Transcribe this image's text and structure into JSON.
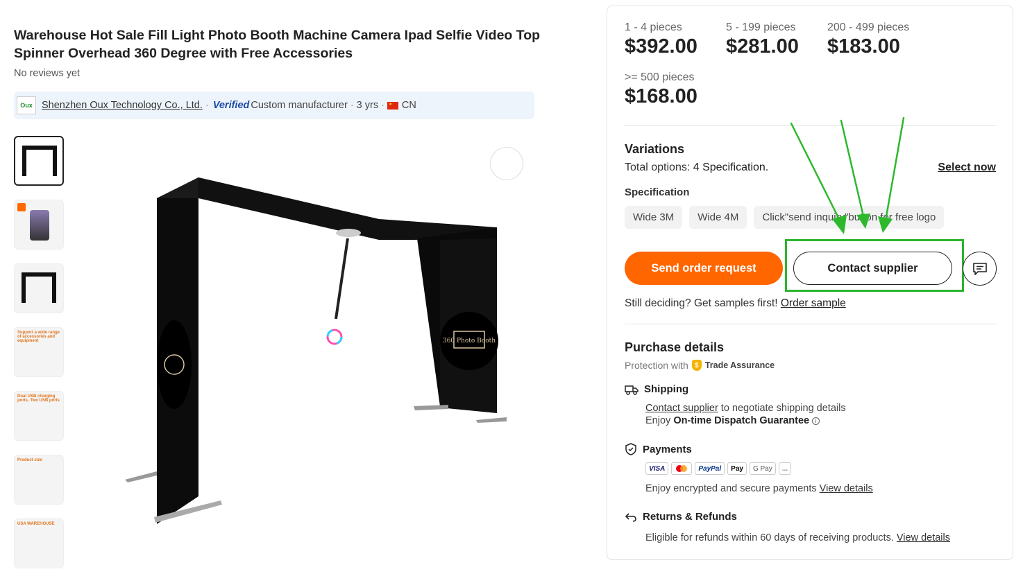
{
  "product": {
    "title": "Warehouse Hot Sale Fill Light Photo Booth Machine Camera Ipad Selfie Video Top Spinner Overhead 360 Degree with Free Accessories",
    "reviews": "No reviews yet"
  },
  "supplier": {
    "logo_text": "Oux",
    "name": "Shenzhen Oux Technology Co., Ltd.",
    "verified": "Verified",
    "type": "Custom manufacturer",
    "years": "3 yrs",
    "country": "CN"
  },
  "image": {
    "sign_text": "360 Photo Booth"
  },
  "thumbnails": [
    {
      "label": ""
    },
    {
      "label": ""
    },
    {
      "label": ""
    },
    {
      "label": "Support a wide range of accessories and equipment"
    },
    {
      "label": "Dual USB charging ports. Two USB ports"
    },
    {
      "label": "Product size"
    },
    {
      "label": "USA WAREHOUSE"
    }
  ],
  "pricing": [
    {
      "qty": "1 - 4 pieces",
      "price": "$392.00"
    },
    {
      "qty": "5 - 199 pieces",
      "price": "$281.00"
    },
    {
      "qty": "200 - 499 pieces",
      "price": "$183.00"
    },
    {
      "qty": ">= 500 pieces",
      "price": "$168.00"
    }
  ],
  "variations": {
    "title": "Variations",
    "total_prefix": "Total options: ",
    "total_value": "4 Specification.",
    "select_now": "Select now",
    "spec_label": "Specification",
    "options": [
      "Wide 3M",
      "Wide 4M",
      "Click\"send inquiry\"button for free logo"
    ]
  },
  "actions": {
    "order": "Send order request",
    "contact": "Contact supplier"
  },
  "samples": {
    "text": "Still deciding? Get samples first!",
    "link": "Order sample"
  },
  "purchase": {
    "title": "Purchase details",
    "protection": "Protection with",
    "trade_assurance": "Trade Assurance",
    "shipping": {
      "title": "Shipping",
      "link": "Contact supplier",
      "text": " to negotiate shipping details",
      "enjoy": "Enjoy ",
      "guarantee": "On-time Dispatch Guarantee"
    },
    "payments": {
      "title": "Payments",
      "logos": [
        "VISA",
        "",
        "PayPal",
        "Pay",
        "G Pay",
        "..."
      ],
      "text": "Enjoy encrypted and secure payments ",
      "link": "View details"
    },
    "returns": {
      "title": "Returns & Refunds",
      "text": "Eligible for refunds within 60 days of receiving products. ",
      "link": "View details"
    }
  },
  "colors": {
    "accent": "#ff6600",
    "highlight": "#2bb52b",
    "annotation_arrow": "#2db82d"
  }
}
